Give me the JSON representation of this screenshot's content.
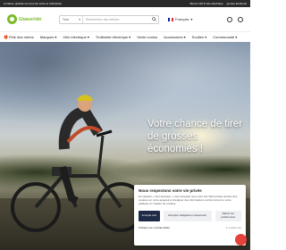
{
  "promo": {
    "left": "Livraison gratuite sur tous les vélos et trottinettes",
    "right_1": "Bonus 120 € vélo électrique",
    "right_2": "groupe facebook"
  },
  "header": {
    "logo": "Gtaseride",
    "search_category": "Tout",
    "search_placeholder": "Recherchez des articles",
    "language": "Français",
    "flag_colors": [
      "#002395",
      "#ffffff",
      "#ed2939"
    ]
  },
  "nav": {
    "items": [
      "Fête des mères",
      "Marques",
      "Vélo électrique",
      "Trottinette électrique",
      "Vente conlus",
      "Accessoires",
      "Soutien",
      "Communauté"
    ]
  },
  "hero": {
    "title": "Votre chance de tirer de grosses économies !",
    "button": "Voy profiter"
  },
  "cookie": {
    "title": "Nous respectons votre vie privée",
    "text": "En cliquant « Tout accepter » vous acceptez que notre site Web puisse stocker des cookies sur votre appareil et divulguer des informations conformément à notre politique en matière de cookies.",
    "accept": "Accepte tout",
    "refuse": "Accepter obligatoire uniquement",
    "prefs": "Définir les préférences",
    "policy_link": "Politique de confidentialité",
    "powered": "Cookie bot",
    "accept_color": "#1e2a46"
  },
  "colors": {
    "brand_green": "#7cbb2a",
    "chat_red": "#e7413b"
  }
}
